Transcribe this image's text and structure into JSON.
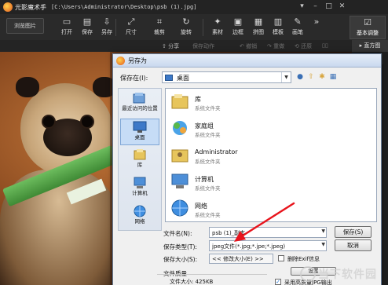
{
  "app": {
    "name": "光影魔术手",
    "path": "[C:\\Users\\Administrator\\Desktop\\psb (1).jpg]"
  },
  "toolbar": {
    "browse": "浏览图片",
    "tools": [
      {
        "label": "打开",
        "icon": "open-icon"
      },
      {
        "label": "保存",
        "icon": "save-icon"
      },
      {
        "label": "另存",
        "icon": "save-as-icon"
      },
      {
        "label": "尺寸",
        "icon": "resize-icon"
      },
      {
        "label": "裁剪",
        "icon": "crop-icon"
      },
      {
        "label": "旋转",
        "icon": "rotate-icon"
      },
      {
        "label": "素材",
        "icon": "material-icon"
      },
      {
        "label": "边框",
        "icon": "border-icon"
      },
      {
        "label": "拼图",
        "icon": "collage-icon"
      },
      {
        "label": "模板",
        "icon": "template-icon"
      },
      {
        "label": "画笔",
        "icon": "brush-icon"
      }
    ],
    "more": "»",
    "active_tab": "基本调整"
  },
  "secondbar": {
    "share": "分享",
    "save_action": "保存动作",
    "undo": "撤销",
    "redo": "重做",
    "restore": "还原",
    "histogram": "直方图"
  },
  "dialog": {
    "title": "另存为",
    "save_in_label": "保存在(I):",
    "save_in_value": "桌面",
    "places": [
      {
        "label": "最近访问的位置",
        "icon": "recent-places-icon"
      },
      {
        "label": "桌面",
        "icon": "desktop-icon"
      },
      {
        "label": "库",
        "icon": "library-icon"
      },
      {
        "label": "计算机",
        "icon": "computer-icon"
      },
      {
        "label": "网络",
        "icon": "network-icon"
      }
    ],
    "files": [
      {
        "name": "库",
        "type": "系统文件夹",
        "icon": "library-folder-icon"
      },
      {
        "name": "家庭组",
        "type": "系统文件夹",
        "icon": "homegroup-icon"
      },
      {
        "name": "Administrator",
        "type": "系统文件夹",
        "icon": "user-folder-icon"
      },
      {
        "name": "计算机",
        "type": "系统文件夹",
        "icon": "computer-icon"
      },
      {
        "name": "网络",
        "type": "系统文件夹",
        "icon": "network-icon"
      }
    ],
    "filename_label": "文件名(N):",
    "filename_value": "psb (1)_副本",
    "filetype_label": "保存类型(T):",
    "filetype_value": "jpeg文件(*.jpg;*.jpe;*.jpeg)",
    "size_label": "保存大小(S):",
    "size_value": "<< 修改大小(E) >>",
    "delete_exif": "删除Exif信息",
    "quality_label": "文件质量",
    "filesize_label": "文件大小: 425KB",
    "high_quality": "采用高质量JPG输出",
    "save_button": "保存(S)",
    "cancel_button": "取消",
    "settings_button": "设置"
  },
  "watermark": {
    "text": "当下软件园"
  }
}
